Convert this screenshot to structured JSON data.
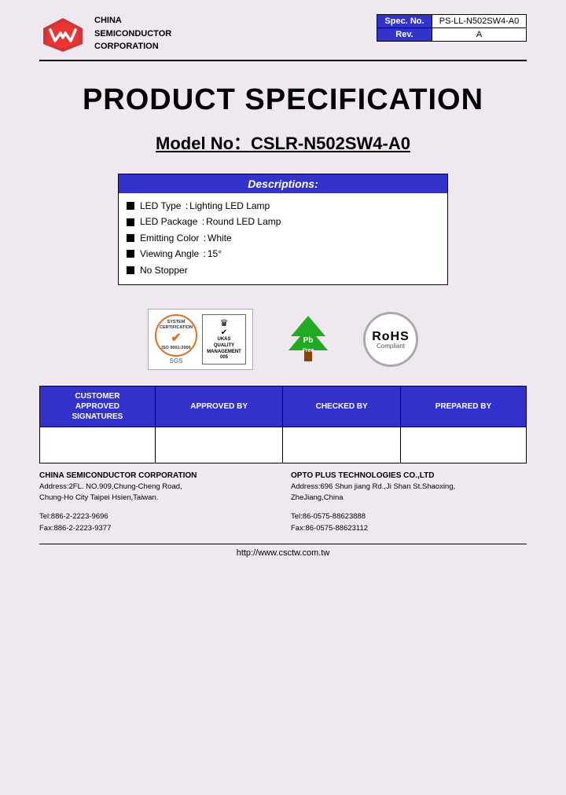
{
  "header": {
    "company_line1": "CHINA",
    "company_line2": "SEMICONDUCTOR",
    "company_line3": "CORPORATION",
    "spec_label": "Spec. No.",
    "spec_value": "PS-LL-N502SW4-A0",
    "rev_label": "Rev.",
    "rev_value": "A"
  },
  "title": {
    "main": "PRODUCT SPECIFICATION",
    "model_prefix": "Model No：CSLR-N502SW4-A0"
  },
  "descriptions": {
    "header": "Descriptions:",
    "rows": [
      {
        "label": "LED Type",
        "sep": ":",
        "value": "Lighting LED Lamp"
      },
      {
        "label": "LED Package",
        "sep": ":",
        "value": "Round LED Lamp"
      },
      {
        "label": "Emitting Color",
        "sep": ":",
        "value": "White"
      },
      {
        "label": "Viewing Angle",
        "sep": ":",
        "value": "15°"
      },
      {
        "label": "No Stopper",
        "sep": "",
        "value": ""
      }
    ]
  },
  "certifications": {
    "iso_text": "ISO 9001:2000",
    "sgs_label": "SGS",
    "ukas_line1": "UKAS",
    "ukas_line2": "QUALITY",
    "ukas_line3": "MANAGEMENT",
    "ukas_num": "005",
    "pb_free_top": "Pb",
    "pb_free_bot": "Free",
    "rohs_top": "RoHS",
    "rohs_bot": "Compliant"
  },
  "signatures": {
    "col1": "CUSTOMER\nAPPROVED\nSIGNATURES",
    "col2": "APPROVED BY",
    "col3": "CHECKED BY",
    "col4": "PREPARED BY"
  },
  "footer": {
    "left": {
      "company": "CHINA SEMICONDUCTOR CORPORATION",
      "address1": "Address:2FL. NO.909,Chung-Cheng Road,",
      "address2": "Chung-Ho City Taipei Hsien,Taiwan.",
      "tel": "Tel:886-2-2223-9696",
      "fax": "Fax:886-2-2223-9377"
    },
    "right": {
      "company": "OPTO PLUS TECHNOLOGIES CO.,LTD",
      "address1": "Address:696 Shun jiang Rd.,Ji Shan St.Shaoxing,",
      "address2": "ZheJiang,China",
      "tel": "Tel:86-0575-88623888",
      "fax": "Fax:86-0575-88623112"
    }
  },
  "website": "http://www.csctw.com.tw"
}
